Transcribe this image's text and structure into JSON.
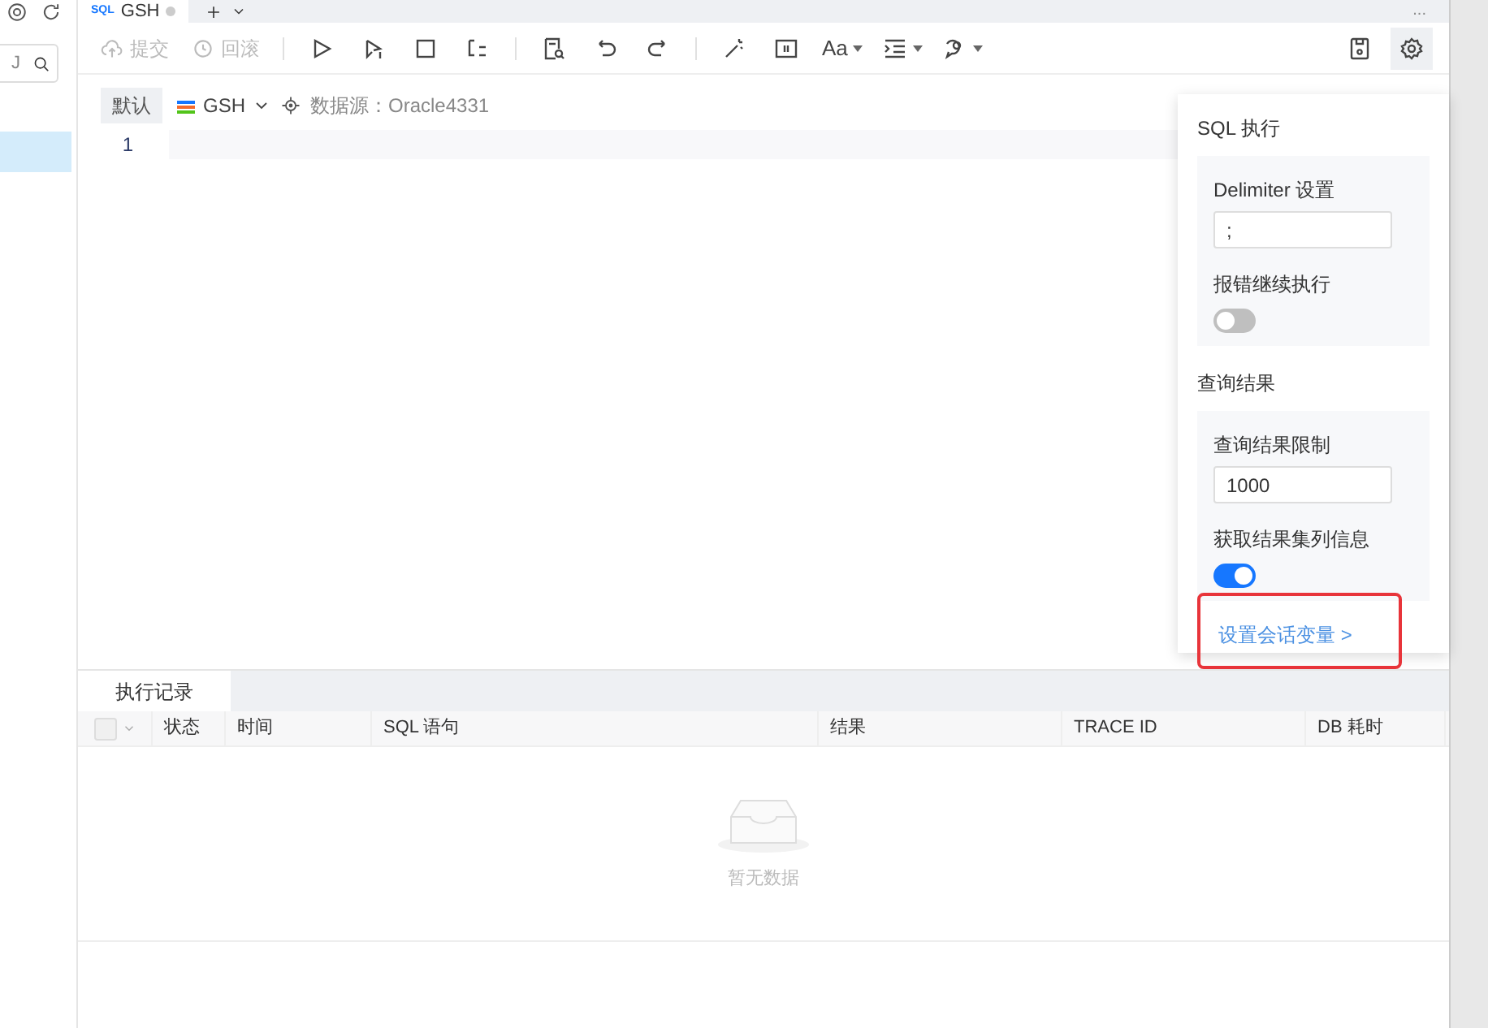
{
  "sidebar": {
    "search": {
      "value": "J"
    },
    "items": [
      {
        "selected": true
      }
    ]
  },
  "tabs": [
    {
      "badge": "SQL",
      "label": "GSH",
      "selected": true
    }
  ],
  "tab_bar": {
    "more": "..."
  },
  "toolbar": {
    "buttons": [
      {
        "kind": "text",
        "label": "提交",
        "disabled": true
      },
      {
        "kind": "text",
        "label": "回滚",
        "disabled": true
      }
    ],
    "font_button": "Aa"
  },
  "info_bar": {
    "mode": "默认",
    "schema": "GSH",
    "datasource": "数据源：Oracle4331"
  },
  "editor": {
    "line_numbers": [
      "1"
    ]
  },
  "settings_panel": {
    "sections": [
      {
        "title": "SQL 执行",
        "fields": [
          {
            "kind": "input",
            "label": "Delimiter 设置",
            "value": ";"
          },
          {
            "kind": "toggle",
            "label": "报错继续执行",
            "on": false
          }
        ]
      },
      {
        "title": "查询结果",
        "fields": [
          {
            "kind": "input",
            "label": "查询结果限制",
            "value": "1000"
          },
          {
            "kind": "toggle",
            "label": "获取结果集列信息",
            "on": true
          }
        ]
      }
    ],
    "link": "设置会话变量 >"
  },
  "results": {
    "tabs": [
      {
        "label": "执行记录",
        "selected": true
      }
    ],
    "select_all": {
      "checked": false
    },
    "columns": [
      "状态",
      "时间",
      "SQL 语句",
      "结果",
      "TRACE ID",
      "DB 耗时"
    ],
    "empty_text": "暂无数据"
  }
}
